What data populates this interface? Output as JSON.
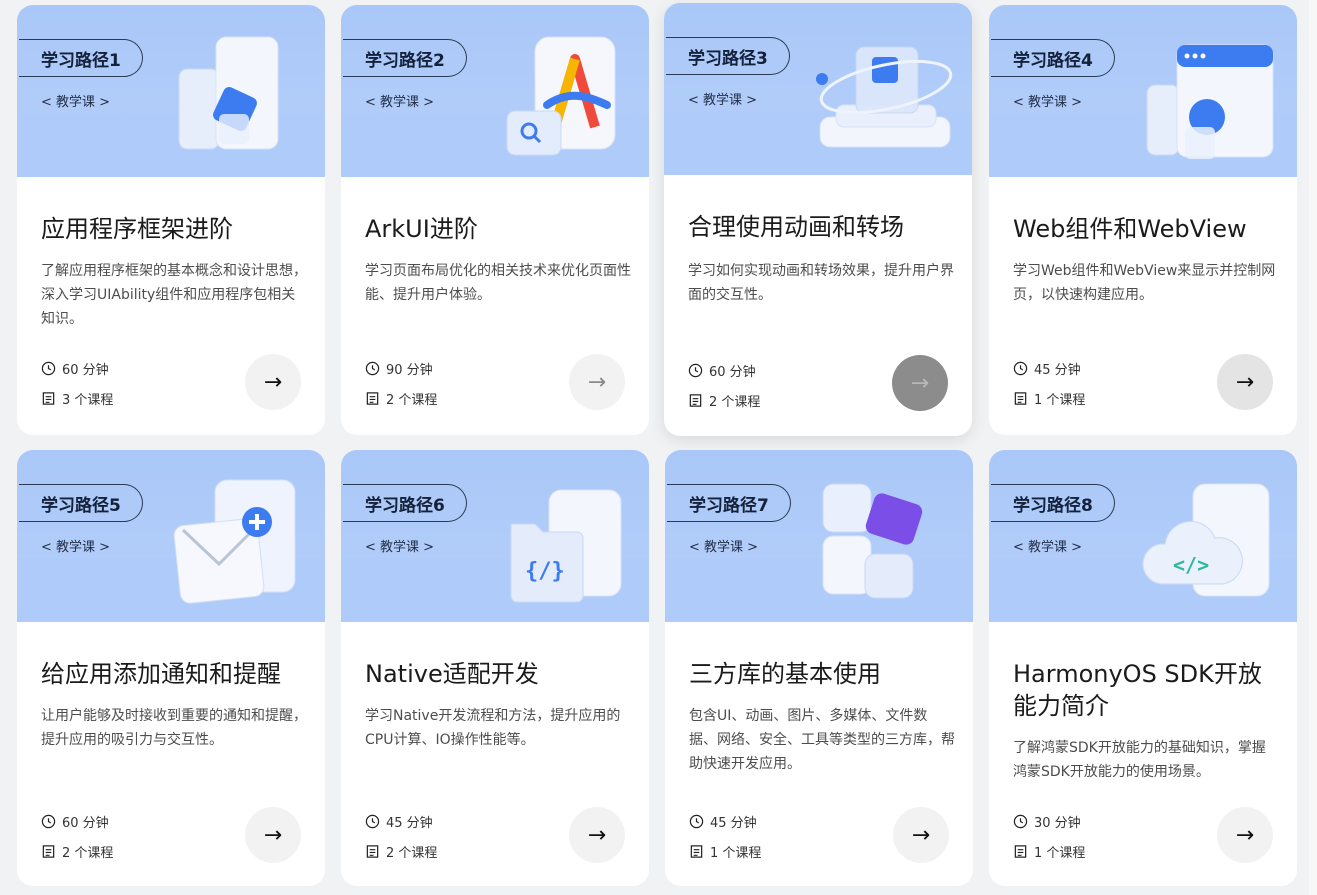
{
  "cards": [
    {
      "tag": "学习路径1",
      "sub": "< 教学课 >",
      "title": "应用程序框架进阶",
      "desc": "了解应用程序框架的基本概念和设计思想，深入学习UIAbility组件和应用程序包相关知识。",
      "duration": "60 分钟",
      "courses": "3 个课程",
      "art": "layered-doc-cube-icon"
    },
    {
      "tag": "学习路径2",
      "sub": "< 教学课 >",
      "title": "ArkUI进阶",
      "desc": "学习页面布局优化的相关技术来优化页面性能、提升用户体验。",
      "duration": "90 分钟",
      "courses": "2 个课程",
      "art": "arkui-logo-icon"
    },
    {
      "tag": "学习路径3",
      "sub": "< 教学课 >",
      "title": "合理使用动画和转场",
      "desc": "学习如何实现动画和转场效果，提升用户界面的交互性。",
      "duration": "60 分钟",
      "courses": "2 个课程",
      "art": "orbit-cube-icon"
    },
    {
      "tag": "学习路径4",
      "sub": "< 教学课 >",
      "title": "Web组件和WebView",
      "desc": "学习Web组件和WebView来显示并控制网页，以快速构建应用。",
      "duration": "45 分钟",
      "courses": "1 个课程",
      "art": "browser-window-icon"
    },
    {
      "tag": "学习路径5",
      "sub": "< 教学课 >",
      "title": "给应用添加通知和提醒",
      "desc": "让用户能够及时接收到重要的通知和提醒，提升应用的吸引力与交互性。",
      "duration": "60 分钟",
      "courses": "2 个课程",
      "art": "mail-plus-icon"
    },
    {
      "tag": "学习路径6",
      "sub": "< 教学课 >",
      "title": "Native适配开发",
      "desc": "学习Native开发流程和方法，提升应用的CPU计算、IO操作性能等。",
      "duration": "45 分钟",
      "courses": "2 个课程",
      "art": "code-folder-icon"
    },
    {
      "tag": "学习路径7",
      "sub": "< 教学课 >",
      "title": "三方库的基本使用",
      "desc": "包含UI、动画、图片、多媒体、文件数据、网络、安全、工具等类型的三方库，帮助快速开发应用。",
      "duration": "45 分钟",
      "courses": "1 个课程",
      "art": "stacked-blocks-icon"
    },
    {
      "tag": "学习路径8",
      "sub": "< 教学课 >",
      "title": "HarmonyOS SDK开放能力简介",
      "desc": "了解鸿蒙SDK开放能力的基础知识，掌握鸿蒙SDK开放能力的使用场景。",
      "duration": "30 分钟",
      "courses": "1 个课程",
      "art": "cloud-code-icon"
    }
  ],
  "arrow_glyph": "→",
  "colors": {
    "banner": "#aecbfa",
    "accent_blue": "#3d7cf0",
    "purple": "#7b4ee8"
  }
}
